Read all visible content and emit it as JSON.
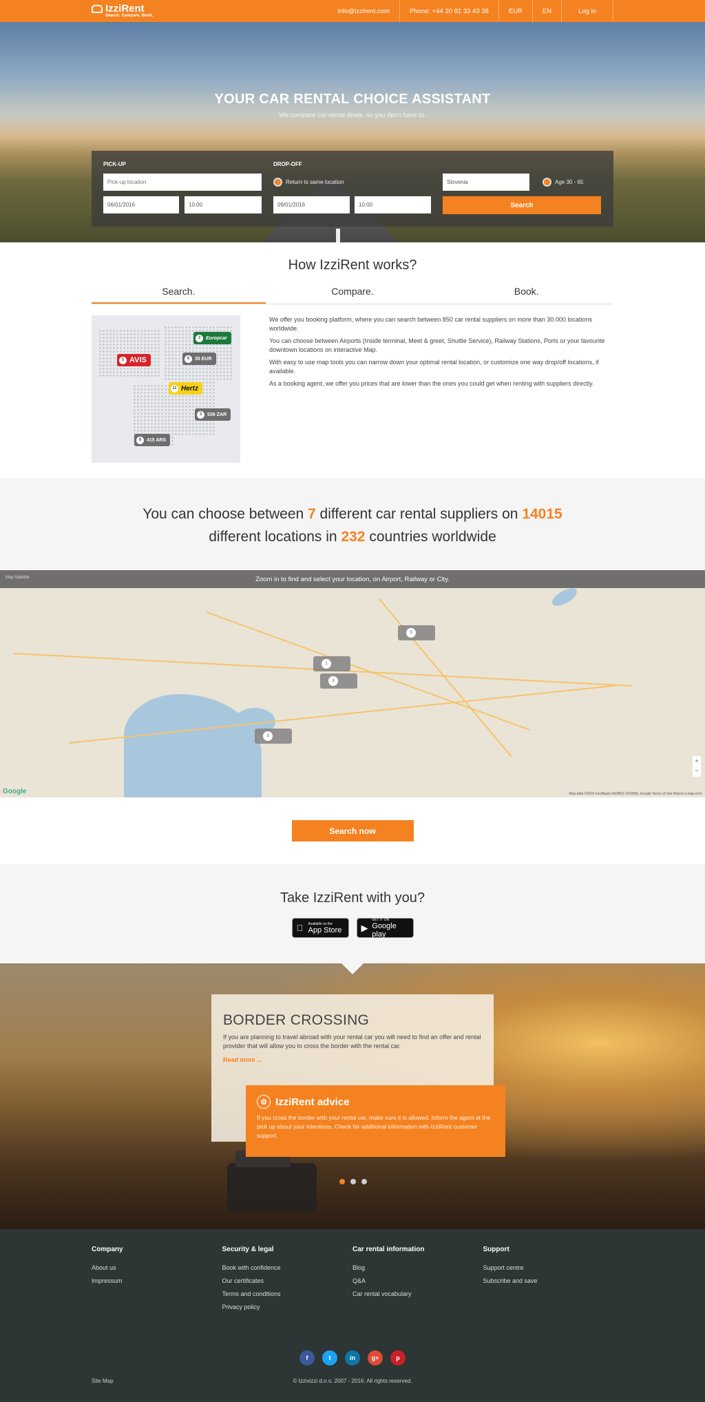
{
  "header": {
    "logo_name": "IzziRent",
    "logo_tagline": "Search. Compare. Book.",
    "email": "info@izzirent.com",
    "phone": "Phone: +44 20 81 33 43 38",
    "currency": "EUR",
    "language": "EN",
    "login": "Log in"
  },
  "hero": {
    "title": "YOUR CAR RENTAL CHOICE ASSISTANT",
    "subtitle": "We compare car rental deals, so you don't have to.",
    "pickup_label": "PICK-UP",
    "dropoff_label": "DROP-OFF",
    "pickup_placeholder": "Pick-up location",
    "return_same": "Return to same location",
    "country": "Slovenia",
    "age": "Age 30 - 65",
    "pickup_date": "06/01/2016",
    "pickup_time": "10:00",
    "dropoff_date": "09/01/2016",
    "dropoff_time": "10:00",
    "search_button": "Search"
  },
  "how": {
    "title": "How IzziRent works?",
    "tabs": [
      "Search.",
      "Compare.",
      "Book."
    ],
    "paragraphs": [
      "We offer you booking platform, where you can search between 850 car rental suppliers on more than 30.000 locations worldwide.",
      "You can choose between Airports (Inside terminal, Meet & greet, Shuttle Service), Railway Stations, Ports or your favourite downtown locations on interactive Map.",
      "With easy to use map tools you can narrow down your optimal rental location, or customize one way drop/off locations, if available.",
      "As a booking agent, we offer you prices that are lower than the ones you could get when renting with suppliers directly."
    ],
    "pins": [
      {
        "num": "5",
        "label": "AVIS",
        "color": "#d8232a"
      },
      {
        "num": "3",
        "label": "Europcar",
        "color": "#1d7a3c"
      },
      {
        "num": "6",
        "label": "35 EUR",
        "color": "#6e6e6e"
      },
      {
        "num": "11",
        "label": "Hertz",
        "color": "#f7d117"
      },
      {
        "num": "3",
        "label": "536 ZAR",
        "color": "#6e6e6e"
      },
      {
        "num": "8",
        "label": "415 ARS",
        "color": "#6e6e6e"
      }
    ]
  },
  "stats": {
    "t1": "You can choose between ",
    "suppliers": "7",
    "t2": " different car rental suppliers on ",
    "locations": "14015",
    "t3": "different locations in ",
    "countries": "232",
    "t4": " countries worldwide"
  },
  "map": {
    "banner": "Zoom in to find and select your location, on Airport, Railway or City.",
    "map_type": "Map   Satellite",
    "clusters": [
      "5",
      "1",
      "3",
      "3"
    ],
    "google": "Google",
    "copyright": "Map data ©2016 GeoBasis-DE/BKG (©2009), Google   Terms of Use   Report a map error",
    "zoom_in": "+",
    "zoom_out": "−",
    "search_now": "Search now"
  },
  "apps": {
    "title": "Take IzziRent with you?",
    "appstore_small": "Available on the",
    "appstore_big": "App Store",
    "google_small": "GET IT ON",
    "google_big": "Google play"
  },
  "border": {
    "title": "BORDER CROSSING",
    "text": "If you are planning to travel abroad with your rental car you will need to find an offer and rental provider that will allow you to cross the border with the rental car.",
    "read_more": "Read more ...",
    "advice_title": "IzziRent advice",
    "advice_text": "If you cross the border with your rental car, make sure it is allowed. Inform the agent at the pick up about your intentions. Check for additional information with IzziRent customer support."
  },
  "footer": {
    "columns": [
      {
        "title": "Company",
        "links": [
          "About us",
          "Impressum"
        ]
      },
      {
        "title": "Security & legal",
        "links": [
          "Book with confidence",
          "Our certificates",
          "Terms and conditions",
          "Privacy policy"
        ]
      },
      {
        "title": "Car rental information",
        "links": [
          "Blog",
          "Q&A",
          "Car rental vocabulary"
        ]
      },
      {
        "title": "Support",
        "links": [
          "Support centre",
          "Subscribe and save"
        ]
      }
    ],
    "social": [
      {
        "icon": "facebook-icon",
        "glyph": "f",
        "color": "#3b5998"
      },
      {
        "icon": "twitter-icon",
        "glyph": "t",
        "color": "#1da1f2"
      },
      {
        "icon": "linkedin-icon",
        "glyph": "in",
        "color": "#0e76a8"
      },
      {
        "icon": "google-plus-icon",
        "glyph": "g+",
        "color": "#dd4b39"
      },
      {
        "icon": "pinterest-icon",
        "glyph": "p",
        "color": "#cb2027"
      }
    ],
    "sitemap": "Site Map",
    "copyright": "© Izzivizzi d.o.o. 2007 - 2016. All rights reserved."
  }
}
